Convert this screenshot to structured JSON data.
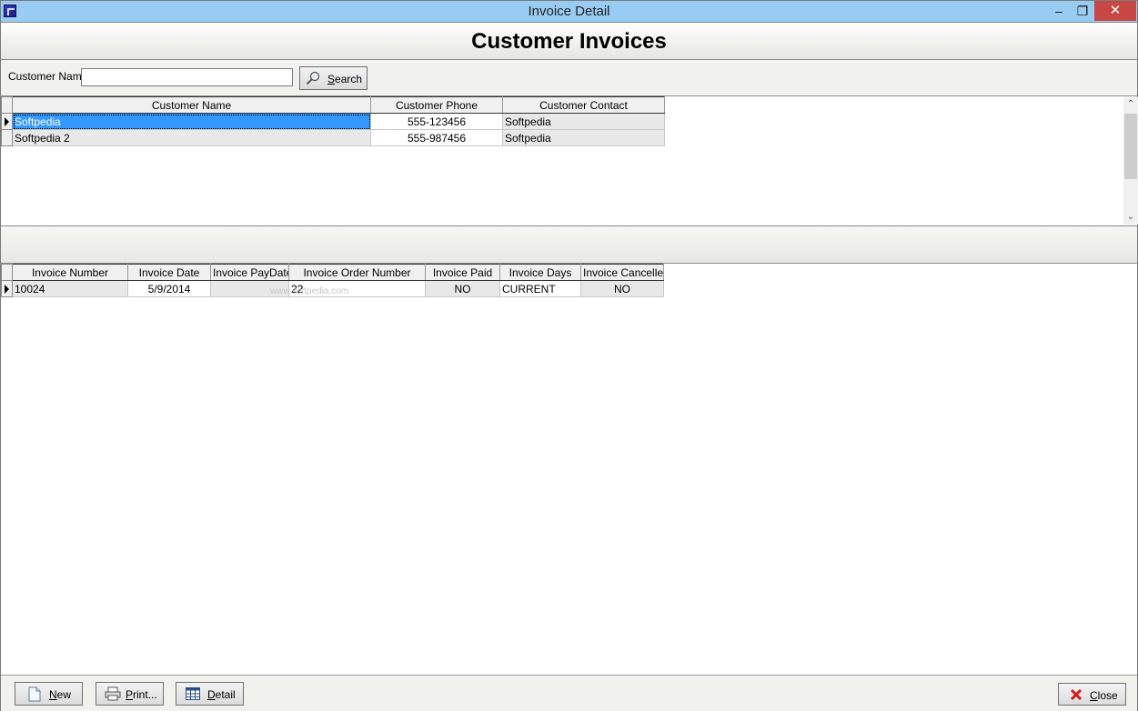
{
  "window": {
    "title": "Invoice Detail",
    "minimize_glyph": "–",
    "restore_glyph": "❐",
    "close_glyph": "✕"
  },
  "header": {
    "title": "Customer Invoices"
  },
  "search": {
    "label": "Customer Name",
    "value": "",
    "button_label": "Search"
  },
  "customers": {
    "columns": [
      "Customer Name",
      "Customer Phone",
      "Customer Contact"
    ],
    "rows": [
      {
        "name": "Softpedia",
        "phone": "555-123456",
        "contact": "Softpedia"
      },
      {
        "name": "Softpedia 2",
        "phone": "555-987456",
        "contact": "Softpedia"
      }
    ],
    "selected_row": 0
  },
  "invoices": {
    "columns": [
      "Invoice Number",
      "Invoice Date",
      "Invoice PayDate",
      "Invoice Order Number",
      "Invoice Paid",
      "Invoice Days",
      "Invoice Cancelled"
    ],
    "rows": [
      {
        "number": "10024",
        "date": "5/9/2014",
        "paydate": "",
        "order_number": "22",
        "paid": "NO",
        "days": "CURRENT",
        "cancelled": "NO"
      }
    ]
  },
  "watermark": "www.softpedia.com",
  "footer": {
    "new_label": "New",
    "print_label": "Print...",
    "detail_label": "Detail",
    "close_label": "Close"
  },
  "colors": {
    "titlebar": "#99ccf3",
    "selection": "#3399ff",
    "close_button": "#c74745"
  },
  "icons": {
    "app": "app-icon",
    "search": "magnifier-icon",
    "new": "document-icon",
    "print": "printer-icon",
    "detail": "table-icon",
    "close": "red-x-icon"
  }
}
